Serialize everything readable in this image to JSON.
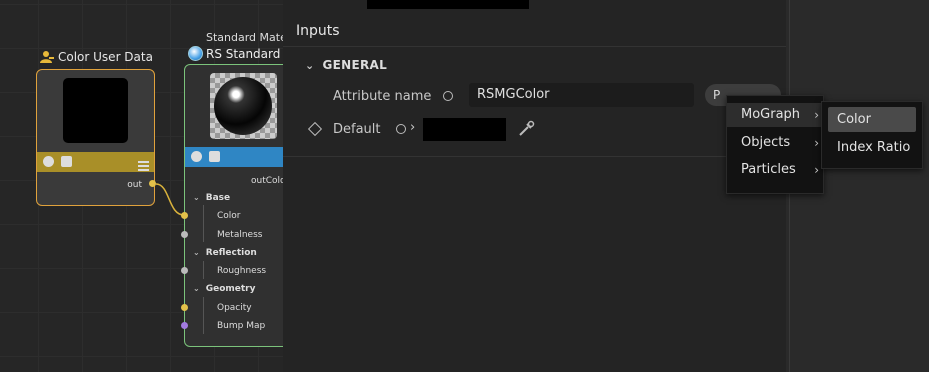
{
  "node_editor": {
    "color_user_data": {
      "title": "Color User Data",
      "output_port": "out",
      "header_color": "#a98f28",
      "border_color": "#e0a23c"
    },
    "rs_standard": {
      "subtitle": "Standard Mate",
      "title": "RS Standard",
      "output_port": "outColo",
      "header_color": "#2f86c4",
      "border_color": "#7bc37b",
      "groups": [
        {
          "label": "Base",
          "items": [
            "Color",
            "Metalness"
          ]
        },
        {
          "label": "Reflection",
          "items": [
            "Roughness"
          ]
        },
        {
          "label": "Geometry",
          "items": [
            "Opacity",
            "Bump Map"
          ]
        }
      ]
    }
  },
  "inputs_panel": {
    "title": "Inputs",
    "section": "GENERAL",
    "attribute_name_label": "Attribute name",
    "attribute_name_value": "RSMGColor",
    "attribute_button_label": "P",
    "default_label": "Default",
    "default_color": "#000000"
  },
  "context_menu": {
    "items": [
      {
        "label": "MoGraph",
        "highlighted": true
      },
      {
        "label": "Objects",
        "highlighted": false
      },
      {
        "label": "Particles",
        "highlighted": false
      }
    ],
    "submenu": {
      "items": [
        {
          "label": "Color",
          "highlighted": true
        },
        {
          "label": "Index Ratio",
          "highlighted": false
        }
      ]
    }
  }
}
